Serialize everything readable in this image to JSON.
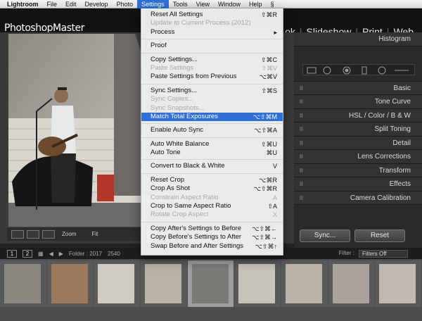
{
  "menubar": {
    "app": "Lightroom",
    "items": [
      "File",
      "Edit",
      "Develop",
      "Photo",
      "Settings",
      "Tools",
      "View",
      "Window",
      "Help"
    ],
    "active": "Settings",
    "script_icon": "§"
  },
  "topbar": {
    "logo": "PhotoshopMaster",
    "modules": [
      "ok",
      "Slideshow",
      "Print",
      "Web"
    ]
  },
  "settings_menu": [
    {
      "label": "Reset All Settings",
      "shortcut": "⇧⌘R",
      "enabled": true
    },
    {
      "label": "Update to Current Process (2012)",
      "shortcut": "",
      "enabled": false
    },
    {
      "label": "Process",
      "shortcut": "▸",
      "enabled": true
    },
    {
      "separator": true
    },
    {
      "label": "Proof",
      "shortcut": "",
      "enabled": true
    },
    {
      "separator": true
    },
    {
      "label": "Copy Settings...",
      "shortcut": "⇧⌘C",
      "enabled": true
    },
    {
      "label": "Paste Settings",
      "shortcut": "⇧⌘V",
      "enabled": false
    },
    {
      "label": "Paste Settings from Previous",
      "shortcut": "⌥⌘V",
      "enabled": true
    },
    {
      "separator": true
    },
    {
      "label": "Sync Settings...",
      "shortcut": "⇧⌘S",
      "enabled": true
    },
    {
      "label": "Sync Copies...",
      "shortcut": "",
      "enabled": false
    },
    {
      "label": "Sync Snapshots...",
      "shortcut": "",
      "enabled": false
    },
    {
      "label": "Match Total Exposures",
      "shortcut": "⌥⇧⌘M",
      "enabled": true,
      "highlighted": true
    },
    {
      "separator": true
    },
    {
      "label": "Enable Auto Sync",
      "shortcut": "⌥⇧⌘A",
      "enabled": true
    },
    {
      "separator": true
    },
    {
      "label": "Auto White Balance",
      "shortcut": "⇧⌘U",
      "enabled": true
    },
    {
      "label": "Auto Tone",
      "shortcut": "⌘U",
      "enabled": true
    },
    {
      "separator": true
    },
    {
      "label": "Convert to Black & White",
      "shortcut": "V",
      "enabled": true
    },
    {
      "separator": true
    },
    {
      "label": "Reset Crop",
      "shortcut": "⌥⌘R",
      "enabled": true
    },
    {
      "label": "Crop As Shot",
      "shortcut": "⌥⇧⌘R",
      "enabled": true
    },
    {
      "label": "Constrain Aspect Ratio",
      "shortcut": "A",
      "enabled": false
    },
    {
      "label": "Crop to Same Aspect Ratio",
      "shortcut": "⇧A",
      "enabled": true
    },
    {
      "label": "Rotate Crop Aspect",
      "shortcut": "X",
      "enabled": false
    },
    {
      "separator": true
    },
    {
      "label": "Copy After's Settings to Before",
      "shortcut": "⌥⇧⌘←",
      "enabled": true
    },
    {
      "label": "Copy Before's Settings to After",
      "shortcut": "⌥⇧⌘→",
      "enabled": true
    },
    {
      "label": "Swap Before and After Settings",
      "shortcut": "⌥⇧⌘↑",
      "enabled": true
    }
  ],
  "right_panel": {
    "histogram": "Histogram",
    "panels": [
      "Basic",
      "Tone Curve",
      "HSL  /  Color  /  B & W",
      "Split Toning",
      "Detail",
      "Lens Corrections",
      "Transform",
      "Effects",
      "Camera Calibration"
    ],
    "sync_button": "Sync...",
    "reset_button": "Reset"
  },
  "toolbar": {
    "zoom_label": "Zoom",
    "fit_label": "Fit"
  },
  "filmstrip_bar": {
    "page1": "1",
    "page2": "2",
    "folder_label": "Folder : 2017",
    "count_text": "2540",
    "filter_label": "Filter :",
    "filter_value": "Filters Off"
  },
  "colors": {
    "menu_highlight": "#2f6fd6",
    "panel_bg": "#2a2a2a",
    "filmstrip_bg": "#4d4d4d"
  }
}
